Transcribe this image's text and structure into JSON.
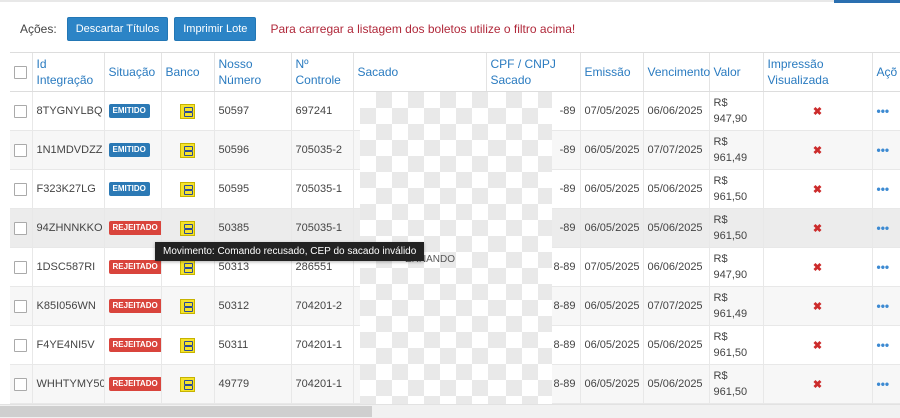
{
  "actions": {
    "label": "Ações:",
    "discard_label": "Descartar Títulos",
    "print_label": "Imprimir Lote",
    "notice": "Para carregar a listagem dos boletos utilize o filtro acima!"
  },
  "table": {
    "headers": {
      "id": "Id Integração",
      "situacao": "Situação",
      "banco": "Banco",
      "nosso_numero": "Nosso Número",
      "controle": "Nº Controle",
      "sacado": "Sacado",
      "cpf": "CPF / CNPJ Sacado",
      "emissao": "Emissão",
      "vencimento": "Vencimento",
      "valor": "Valor",
      "impressao": "Impressão Visualizada",
      "acoes": "Açõ"
    },
    "rows": [
      {
        "id": "8TYGNYLBQ",
        "status": "EMITIDO",
        "nosso": "50597",
        "controle": "697241",
        "cpf": "-89",
        "emissao": "07/05/2025",
        "vencimento": "06/06/2025",
        "valor_cur": "R$",
        "valor_num": "947,90",
        "impressao": "✖",
        "acoes": "•••"
      },
      {
        "id": "1N1MDVDZZ",
        "status": "EMITIDO",
        "nosso": "50596",
        "controle": "705035-2",
        "cpf": "-89",
        "emissao": "06/05/2025",
        "vencimento": "07/07/2025",
        "valor_cur": "R$",
        "valor_num": "961,49",
        "impressao": "✖",
        "acoes": "•••"
      },
      {
        "id": "F323K27LG",
        "status": "EMITIDO",
        "nosso": "50595",
        "controle": "705035-1",
        "cpf": "-89",
        "emissao": "06/05/2025",
        "vencimento": "05/06/2025",
        "valor_cur": "R$",
        "valor_num": "961,50",
        "impressao": "✖",
        "acoes": "•••"
      },
      {
        "id": "94ZHNNKKO",
        "status": "REJEITADO",
        "nosso": "50385",
        "controle": "705035-1",
        "cpf": "-89",
        "emissao": "06/05/2025",
        "vencimento": "05/06/2025",
        "valor_cur": "R$",
        "valor_num": "961,50",
        "impressao": "✖",
        "acoes": "•••"
      },
      {
        "id": "1DSC587RI",
        "status": "REJEITADO",
        "nosso": "50313",
        "controle": "286551",
        "cpf": "8-89",
        "emissao": "07/05/2025",
        "vencimento": "06/06/2025",
        "valor_cur": "R$",
        "valor_num": "947,90",
        "impressao": "✖",
        "acoes": "•••"
      },
      {
        "id": "K85I056WN",
        "status": "REJEITADO",
        "nosso": "50312",
        "controle": "704201-2",
        "cpf": "8-89",
        "emissao": "06/05/2025",
        "vencimento": "07/07/2025",
        "valor_cur": "R$",
        "valor_num": "961,49",
        "impressao": "✖",
        "acoes": "•••"
      },
      {
        "id": "F4YE4NI5V",
        "status": "REJEITADO",
        "nosso": "50311",
        "controle": "704201-1",
        "cpf": "8-89",
        "emissao": "06/05/2025",
        "vencimento": "05/06/2025",
        "valor_cur": "R$",
        "valor_num": "961,50",
        "impressao": "✖",
        "acoes": "•••"
      },
      {
        "id": "WHHTYMY50",
        "status": "REJEITADO",
        "nosso": "49779",
        "controle": "704201-1",
        "cpf": "8-89",
        "emissao": "06/05/2025",
        "vencimento": "05/06/2025",
        "valor_cur": "R$",
        "valor_num": "961,50",
        "impressao": "✖",
        "acoes": "•••"
      }
    ]
  },
  "tooltip": "Movimento: Comando recusado, CEP do sacado inválido",
  "residual_text": "ERNANDO",
  "colors": {
    "primary_button": "#2c84c6",
    "notice_text": "#b0283a",
    "header_text": "#2a7bc0",
    "badge_emitido": "#2b79b5",
    "badge_rejeitado": "#d9443c",
    "bank_icon": "#f5e32a"
  },
  "icons": {
    "bank": "banco-do-brasil-icon",
    "print_status": "red-x-icon",
    "row_actions": "ellipsis-icon"
  }
}
